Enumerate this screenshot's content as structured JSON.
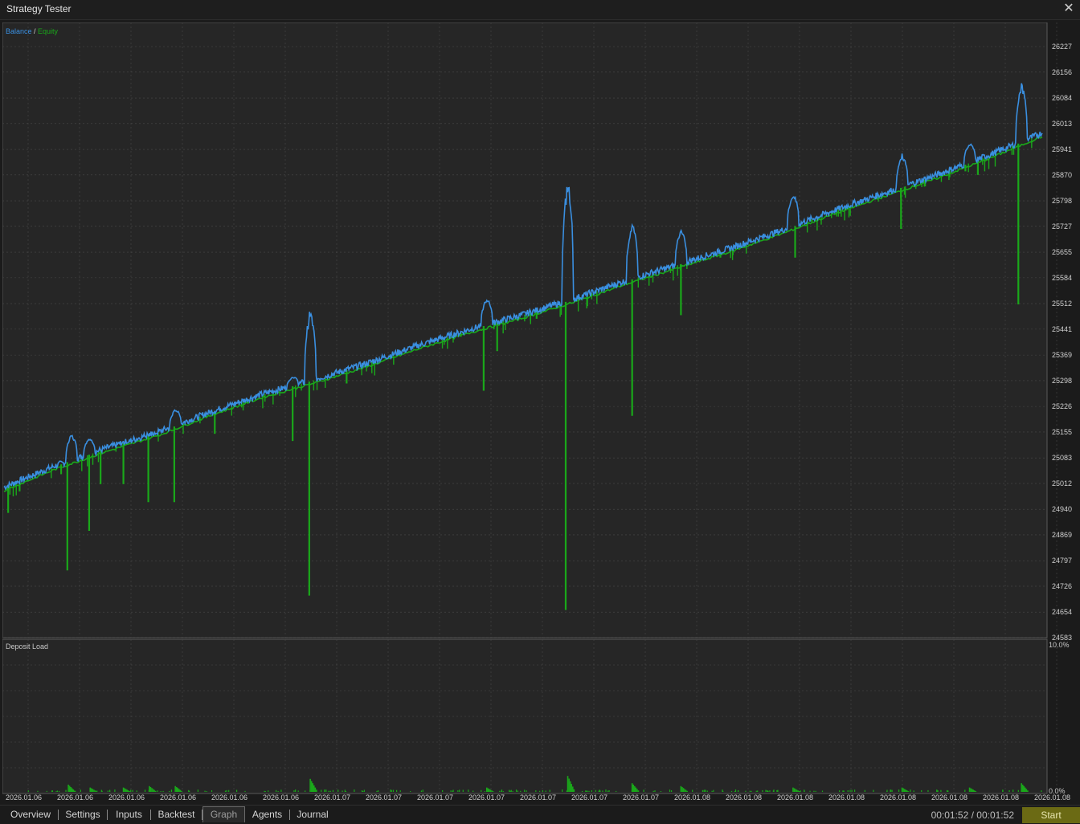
{
  "window": {
    "title": "Strategy Tester"
  },
  "legend": {
    "balance": "Balance",
    "separator": " / ",
    "equity": "Equity"
  },
  "sub_panel": {
    "title": "Deposit Load",
    "top_label": "10.0%",
    "bottom_label": "0.0%"
  },
  "x_labels": [
    "2026.01.06",
    "2026.01.06",
    "2026.01.06",
    "2026.01.06",
    "2026.01.06",
    "2026.01.06",
    "2026.01.07",
    "2026.01.07",
    "2026.01.07",
    "2026.01.07",
    "2026.01.07",
    "2026.01.07",
    "2026.01.07",
    "2026.01.08",
    "2026.01.08",
    "2026.01.08",
    "2026.01.08",
    "2026.01.08",
    "2026.01.08",
    "2026.01.08",
    "2026.01.08"
  ],
  "colors": {
    "balance": "#3a8fe0",
    "equity": "#1aa81a",
    "grid": "#4a4a4a",
    "background": "#262626",
    "accent": "#6b6a14"
  },
  "tabs": [
    {
      "label": "Overview",
      "active": false
    },
    {
      "label": "Settings",
      "active": false
    },
    {
      "label": "Inputs",
      "active": false
    },
    {
      "label": "Backtest",
      "active": false
    },
    {
      "label": "Graph",
      "active": true
    },
    {
      "label": "Agents",
      "active": false
    },
    {
      "label": "Journal",
      "active": false
    }
  ],
  "status": {
    "timer": "00:01:52 / 00:01:52",
    "start_label": "Start"
  },
  "chart_data": {
    "type": "line",
    "title": "",
    "ylim": [
      24583,
      26227
    ],
    "y_ticks": [
      "26227",
      "26156",
      "26084",
      "26013",
      "25941",
      "25870",
      "25798",
      "25727",
      "25655",
      "25584",
      "25512",
      "25441",
      "25369",
      "25298",
      "25226",
      "25155",
      "25083",
      "25012",
      "24940",
      "24869",
      "24797",
      "24726",
      "24654",
      "24583"
    ],
    "x_range": [
      0,
      100
    ],
    "series": [
      {
        "name": "Balance",
        "x": [
          0,
          5,
          10,
          15,
          20,
          25,
          30,
          35,
          40,
          45,
          50,
          55,
          60,
          65,
          70,
          75,
          80,
          85,
          90,
          95,
          100
        ],
        "y": [
          25000,
          25060,
          25110,
          25155,
          25210,
          25260,
          25300,
          25345,
          25395,
          25440,
          25480,
          25525,
          25575,
          25620,
          25665,
          25715,
          25770,
          25820,
          25870,
          25925,
          25985
        ]
      },
      {
        "name": "Equity",
        "x": [
          0,
          5,
          10,
          15,
          20,
          25,
          30,
          35,
          40,
          45,
          50,
          55,
          60,
          65,
          70,
          75,
          80,
          85,
          90,
          95,
          100
        ],
        "y": [
          25000,
          25060,
          25110,
          25155,
          25210,
          25260,
          25300,
          25345,
          25395,
          25440,
          25480,
          25525,
          25575,
          25620,
          25665,
          25715,
          25770,
          25820,
          25870,
          25925,
          25985
        ]
      }
    ],
    "balance_spikes": [
      {
        "x": 6.5,
        "peak": 25150
      },
      {
        "x": 8.2,
        "peak": 25140
      },
      {
        "x": 11.5,
        "peak": 25120
      },
      {
        "x": 14.0,
        "peak": 25140
      },
      {
        "x": 16.5,
        "peak": 25220
      },
      {
        "x": 27.8,
        "peak": 25310
      },
      {
        "x": 29.5,
        "peak": 25500
      },
      {
        "x": 46.5,
        "peak": 25530
      },
      {
        "x": 54.3,
        "peak": 25870
      },
      {
        "x": 60.5,
        "peak": 25740
      },
      {
        "x": 65.2,
        "peak": 25720
      },
      {
        "x": 76.0,
        "peak": 25820
      },
      {
        "x": 86.5,
        "peak": 25930
      },
      {
        "x": 93.0,
        "peak": 25960
      },
      {
        "x": 98.0,
        "peak": 26130
      }
    ],
    "equity_drops": [
      {
        "x": 0.4,
        "low": 24930
      },
      {
        "x": 1.5,
        "low": 24990
      },
      {
        "x": 6.1,
        "low": 24770
      },
      {
        "x": 8.2,
        "low": 24880
      },
      {
        "x": 9.3,
        "low": 25010
      },
      {
        "x": 11.5,
        "low": 25010
      },
      {
        "x": 13.9,
        "low": 24960
      },
      {
        "x": 16.4,
        "low": 24960
      },
      {
        "x": 20.3,
        "low": 25150
      },
      {
        "x": 27.8,
        "low": 25130
      },
      {
        "x": 29.4,
        "low": 24700
      },
      {
        "x": 33.0,
        "low": 25290
      },
      {
        "x": 44.0,
        "low": 25420
      },
      {
        "x": 46.2,
        "low": 25270
      },
      {
        "x": 47.5,
        "low": 25380
      },
      {
        "x": 51.3,
        "low": 25470
      },
      {
        "x": 54.1,
        "low": 24660
      },
      {
        "x": 60.5,
        "low": 25200
      },
      {
        "x": 65.2,
        "low": 25480
      },
      {
        "x": 69.0,
        "low": 25640
      },
      {
        "x": 76.2,
        "low": 25640
      },
      {
        "x": 77.8,
        "low": 25740
      },
      {
        "x": 86.4,
        "low": 25720
      },
      {
        "x": 87.6,
        "low": 25850
      },
      {
        "x": 92.6,
        "low": 25880
      },
      {
        "x": 93.8,
        "low": 25870
      },
      {
        "x": 97.7,
        "low": 25510
      }
    ],
    "deposit_load": {
      "ylim": [
        0,
        10
      ],
      "bars": [
        {
          "x": 6.2,
          "value": 0.5
        },
        {
          "x": 8.3,
          "value": 0.3
        },
        {
          "x": 11.5,
          "value": 0.3
        },
        {
          "x": 14.0,
          "value": 0.4
        },
        {
          "x": 16.5,
          "value": 0.4
        },
        {
          "x": 29.5,
          "value": 0.9
        },
        {
          "x": 46.5,
          "value": 0.3
        },
        {
          "x": 54.3,
          "value": 1.1
        },
        {
          "x": 60.5,
          "value": 0.6
        },
        {
          "x": 65.2,
          "value": 0.4
        },
        {
          "x": 76.0,
          "value": 0.3
        },
        {
          "x": 86.5,
          "value": 0.3
        },
        {
          "x": 93.0,
          "value": 0.3
        },
        {
          "x": 98.0,
          "value": 0.6
        }
      ]
    }
  }
}
